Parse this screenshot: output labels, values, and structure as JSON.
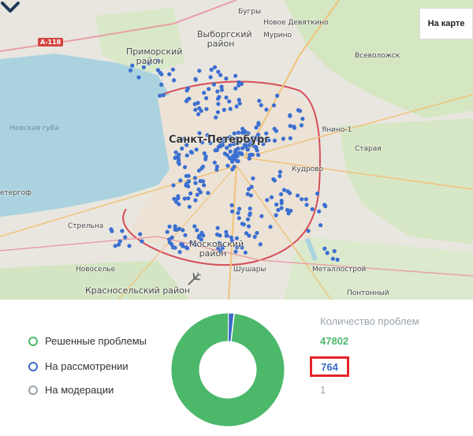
{
  "map": {
    "button_label": "На карте",
    "places": [
      {
        "name": "Бугры",
        "cls": "small"
      },
      {
        "name": "Новое Девяткино",
        "cls": "small"
      },
      {
        "name": "Мурино",
        "cls": "small"
      },
      {
        "name": "Приморский район",
        "cls": "mid"
      },
      {
        "name": "Выборгский район",
        "cls": "mid"
      },
      {
        "name": "Всеволожск",
        "cls": "small"
      },
      {
        "name": "Невская губа",
        "cls": "water"
      },
      {
        "name": "Санкт-Петербург",
        "cls": "big"
      },
      {
        "name": "Янино-1",
        "cls": "small"
      },
      {
        "name": "Старая",
        "cls": "small"
      },
      {
        "name": "Кудрово",
        "cls": "small"
      },
      {
        "name": "етергоф",
        "cls": "small"
      },
      {
        "name": "Стрельна",
        "cls": "small"
      },
      {
        "name": "Московский район",
        "cls": "mid"
      },
      {
        "name": "Новосельe",
        "cls": "small"
      },
      {
        "name": "Шушары",
        "cls": "small"
      },
      {
        "name": "Металлострой",
        "cls": "small"
      },
      {
        "name": "Красносельский район",
        "cls": "mid"
      },
      {
        "name": "Понтонный",
        "cls": "small"
      },
      {
        "name": "А-118",
        "cls": "road"
      }
    ],
    "colors": {
      "marker": "#3c6fd1",
      "water": "#aad3df",
      "land": "#e9e6df",
      "green": "#c8e0b4",
      "city": "#ece3d6",
      "ring_road": "#d64d57"
    },
    "icons": {
      "chevron": "chevron-down-icon",
      "airport": "plane-icon"
    }
  },
  "stats": {
    "legend": [
      {
        "label": "Решенные проблемы",
        "color": "#4cb86a"
      },
      {
        "label": "На рассмотрении",
        "color": "#3a6bc4"
      },
      {
        "label": "На модерации",
        "color": "#9aa4ad"
      }
    ],
    "count_title": "Количество проблем",
    "counts": {
      "resolved": "47802",
      "review": "764",
      "moderation": "1"
    },
    "highlight_color": "#e3242b"
  },
  "chart_data": {
    "type": "pie",
    "donut": true,
    "categories": [
      "Решенные проблемы",
      "На рассмотрении",
      "На модерации"
    ],
    "values": [
      47802,
      764,
      1
    ],
    "colors": [
      "#4cb86a",
      "#3a6bc4",
      "#9aa4ad"
    ],
    "title": "",
    "legend": "left"
  }
}
